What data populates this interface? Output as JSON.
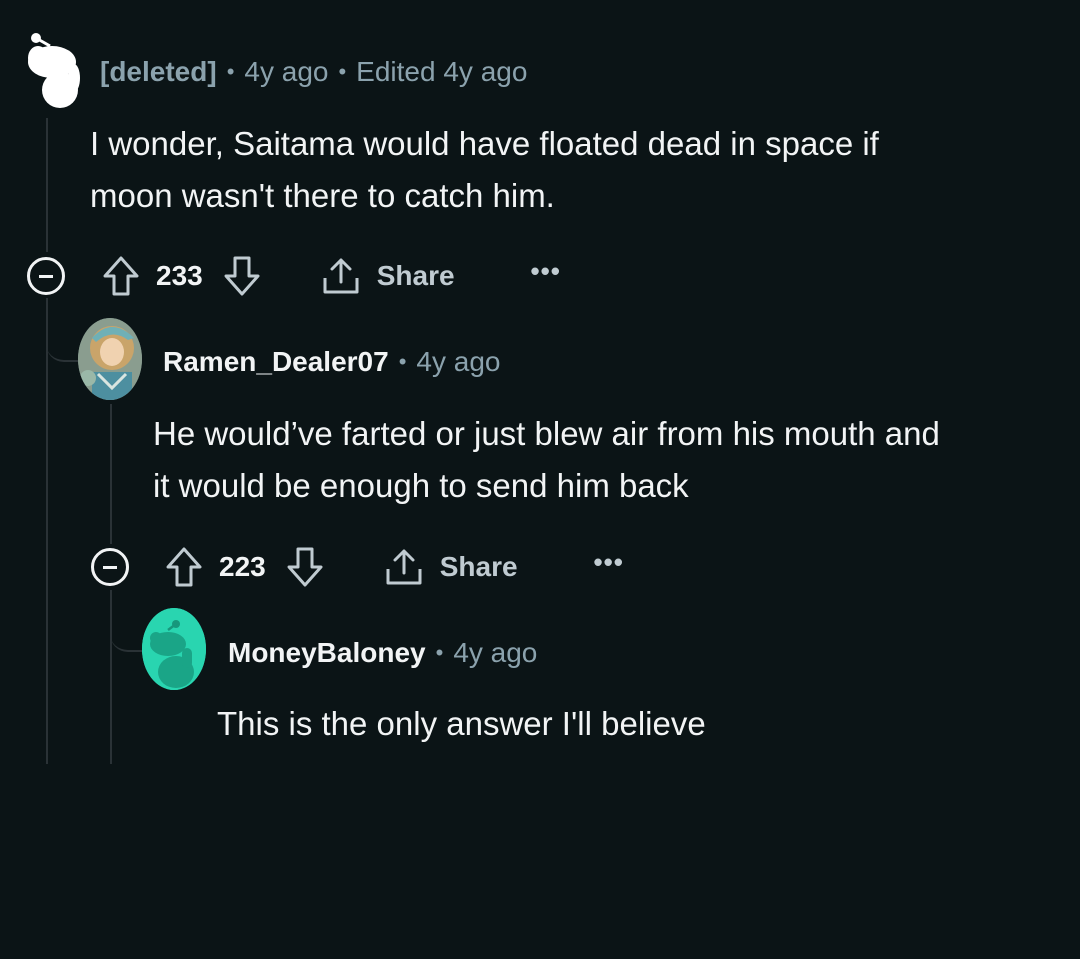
{
  "comments": [
    {
      "author": "[deleted]",
      "time": "4y ago",
      "edited": "Edited 4y ago",
      "body_line1": "I wonder, Saitama would have floated dead in space if",
      "body_line2": "moon wasn't there to catch him.",
      "score": "233",
      "share_label": "Share",
      "more_label": "•••",
      "avatar_icon": "snoo-default-icon"
    },
    {
      "author": "Ramen_Dealer07",
      "time": "4y ago",
      "body_line1": "He would’ve farted or just blew air from his mouth and",
      "body_line2": "it would be enough to send him back",
      "score": "223",
      "share_label": "Share",
      "more_label": "•••",
      "avatar_icon": "anime-avatar-icon"
    },
    {
      "author": "MoneyBaloney",
      "time": "4y ago",
      "body_line1": "This is the only answer I'll believe",
      "avatar_icon": "snoo-teal-icon",
      "avatar_color": "#29d5b0"
    }
  ],
  "separator": "•"
}
